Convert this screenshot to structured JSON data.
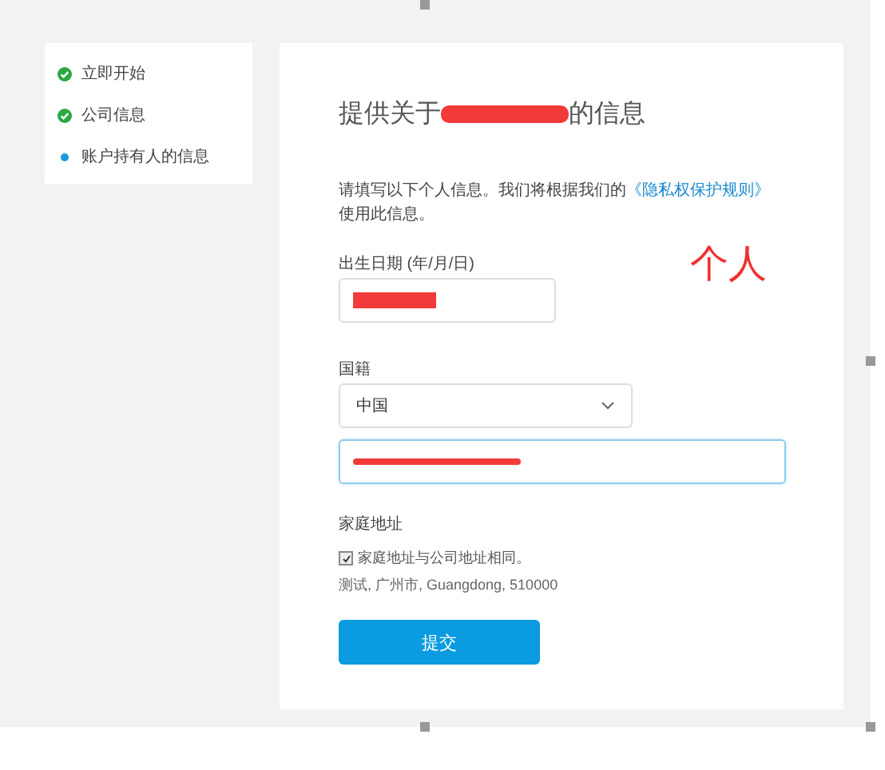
{
  "steps": [
    {
      "label": "立即开始",
      "done": true
    },
    {
      "label": "公司信息",
      "done": true
    },
    {
      "label": "账户持有人的信息",
      "done": false
    }
  ],
  "form": {
    "title_before": "提供关于",
    "title_redacted": true,
    "title_after": "的信息",
    "intro_before": "请填写以下个人信息。我们将根据我们的",
    "intro_link": "《隐私权保护规则》",
    "intro_after": "使用此信息。",
    "birth_label": "出生日期 (年/月/日)",
    "birth_redacted": true,
    "nationality_label": "国籍",
    "nationality_value": "中国",
    "id_redacted": true,
    "id_focused": true,
    "address_heading": "家庭地址",
    "same_address_label": "家庭地址与公司地址相同。",
    "same_address_checked": true,
    "address": "测试, 广州市, Guangdong, 510000",
    "submit": "提交"
  },
  "annotation": "个人"
}
